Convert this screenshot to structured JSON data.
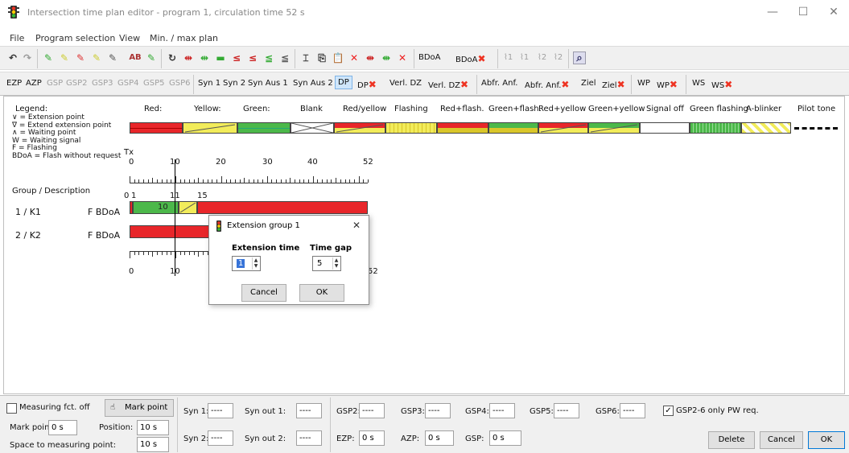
{
  "window": {
    "title": "Intersection time plan editor - program 1, circulation time 52 s",
    "minimize": "—",
    "maximize": "☐",
    "close": "✕"
  },
  "menu": [
    "File",
    "Program selection",
    "View",
    "Min. / max plan"
  ],
  "toolbar1": {
    "bdoa": "BDoA",
    "bdoa2": "BDoA",
    "search_icon": "search-icon",
    "p1": "1",
    "p2": "1",
    "p3": "2",
    "p4": "2"
  },
  "toolbar2": {
    "ezp": "EZP",
    "azp": "AZP",
    "gsp": "GSP",
    "gsp2": "GSP2",
    "gsp3": "GSP3",
    "gsp4": "GSP4",
    "gsp5": "GSP5",
    "gsp6": "GSP6",
    "syn1": "Syn 1",
    "syn2": "Syn 2",
    "synaus1": "Syn Aus 1",
    "synaus2": "Syn Aus 2",
    "dp": "DP",
    "dpx": "DP",
    "verldz": "Verl. DZ",
    "verldzx": "Verl. DZ",
    "abfranf": "Abfr. Anf.",
    "abfranfx": "Abfr. Anf.",
    "ziel": "Ziel",
    "zielx": "Ziel",
    "wp": "WP",
    "wpx": "WP",
    "ws": "WS",
    "wsx": "WS"
  },
  "legend": {
    "title": "Legend:",
    "lines": [
      "∨ = Extension point",
      "∇ = Extend extension point",
      "∧ = Waiting point",
      "W = Waiting signal",
      "F = Flashing",
      "BDoA = Flash without request"
    ],
    "items": [
      "Red:",
      "Yellow:",
      "Green:",
      "Blank",
      "Red/yellow",
      "Flashing",
      "Red+flash.",
      "Green+flash.",
      "Red+yellow",
      "Green+yellow",
      "Signal off",
      "Green flashing",
      "A-blinker",
      "Pilot tone"
    ]
  },
  "timeline": {
    "tx": "Tx",
    "ticks": [
      "0",
      "10",
      "20",
      "30",
      "40",
      "52"
    ],
    "group_header": "Group / Description",
    "mark_ticks": [
      "0",
      "1",
      "11",
      "15"
    ],
    "bottom_ticks": [
      "0",
      "10",
      "52"
    ]
  },
  "groups": [
    {
      "name": "1 / K1",
      "flags": "F  BDoA",
      "green_label": "10"
    },
    {
      "name": "2 / K2",
      "flags": "F  BDoA"
    }
  ],
  "dialog": {
    "title": "Extension group 1",
    "close": "✕",
    "ext_label": "Extension time",
    "gap_label": "Time gap",
    "ext_value": "1",
    "gap_value": "5",
    "cancel": "Cancel",
    "ok": "OK"
  },
  "bottom": {
    "measuring": "Measuring fct. off",
    "mark_point_btn": "Mark point",
    "mark_point_label": "Mark point:",
    "mark_point_val": "0 s",
    "position_label": "Position:",
    "position_val": "10 s",
    "space_label": "Space to measuring point:",
    "space_val": "10 s",
    "syn1": "Syn 1:",
    "syn1_val": "----",
    "synout1": "Syn out 1:",
    "synout1_val": "----",
    "syn2": "Syn 2:",
    "syn2_val": "----",
    "synout2": "Syn out 2:",
    "synout2_val": "----",
    "gsp2": "GSP2:",
    "gsp2_val": "----",
    "gsp3": "GSP3:",
    "gsp3_val": "----",
    "gsp4": "GSP4:",
    "gsp4_val": "----",
    "gsp5": "GSP5:",
    "gsp5_val": "----",
    "gsp6": "GSP6:",
    "gsp6_val": "----",
    "gsp_only": "GSP2-6 only PW req.",
    "ezp": "EZP:",
    "ezp_val": "0 s",
    "azp": "AZP:",
    "azp_val": "0 s",
    "gsp": "GSP:",
    "gsp_val": "0 s",
    "delete": "Delete",
    "cancel": "Cancel",
    "ok": "OK"
  },
  "colors": {
    "red": "#e8262a",
    "yellow": "#f2ec5a",
    "green": "#4cb84a",
    "select": "#cfe6fb"
  }
}
